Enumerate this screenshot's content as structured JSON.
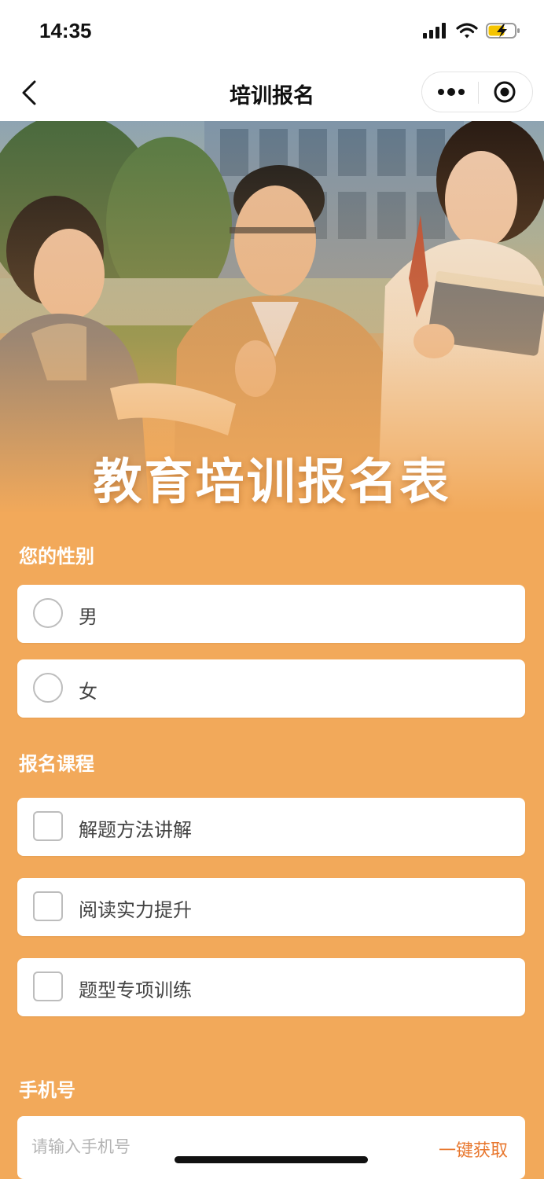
{
  "status_bar": {
    "time": "14:35"
  },
  "nav": {
    "title": "培训报名"
  },
  "hero": {
    "title": "教育培训报名表"
  },
  "gender": {
    "label": "您的性别",
    "options": [
      {
        "label": "男"
      },
      {
        "label": "女"
      }
    ]
  },
  "courses": {
    "label": "报名课程",
    "options": [
      {
        "label": "解题方法讲解"
      },
      {
        "label": "阅读实力提升"
      },
      {
        "label": "题型专项训练"
      }
    ]
  },
  "phone": {
    "label": "手机号",
    "placeholder": "请输入手机号",
    "value": "",
    "quick_fill_label": "一键获取"
  },
  "colors": {
    "accent": "#f2a95a",
    "link": "#e8772e"
  }
}
